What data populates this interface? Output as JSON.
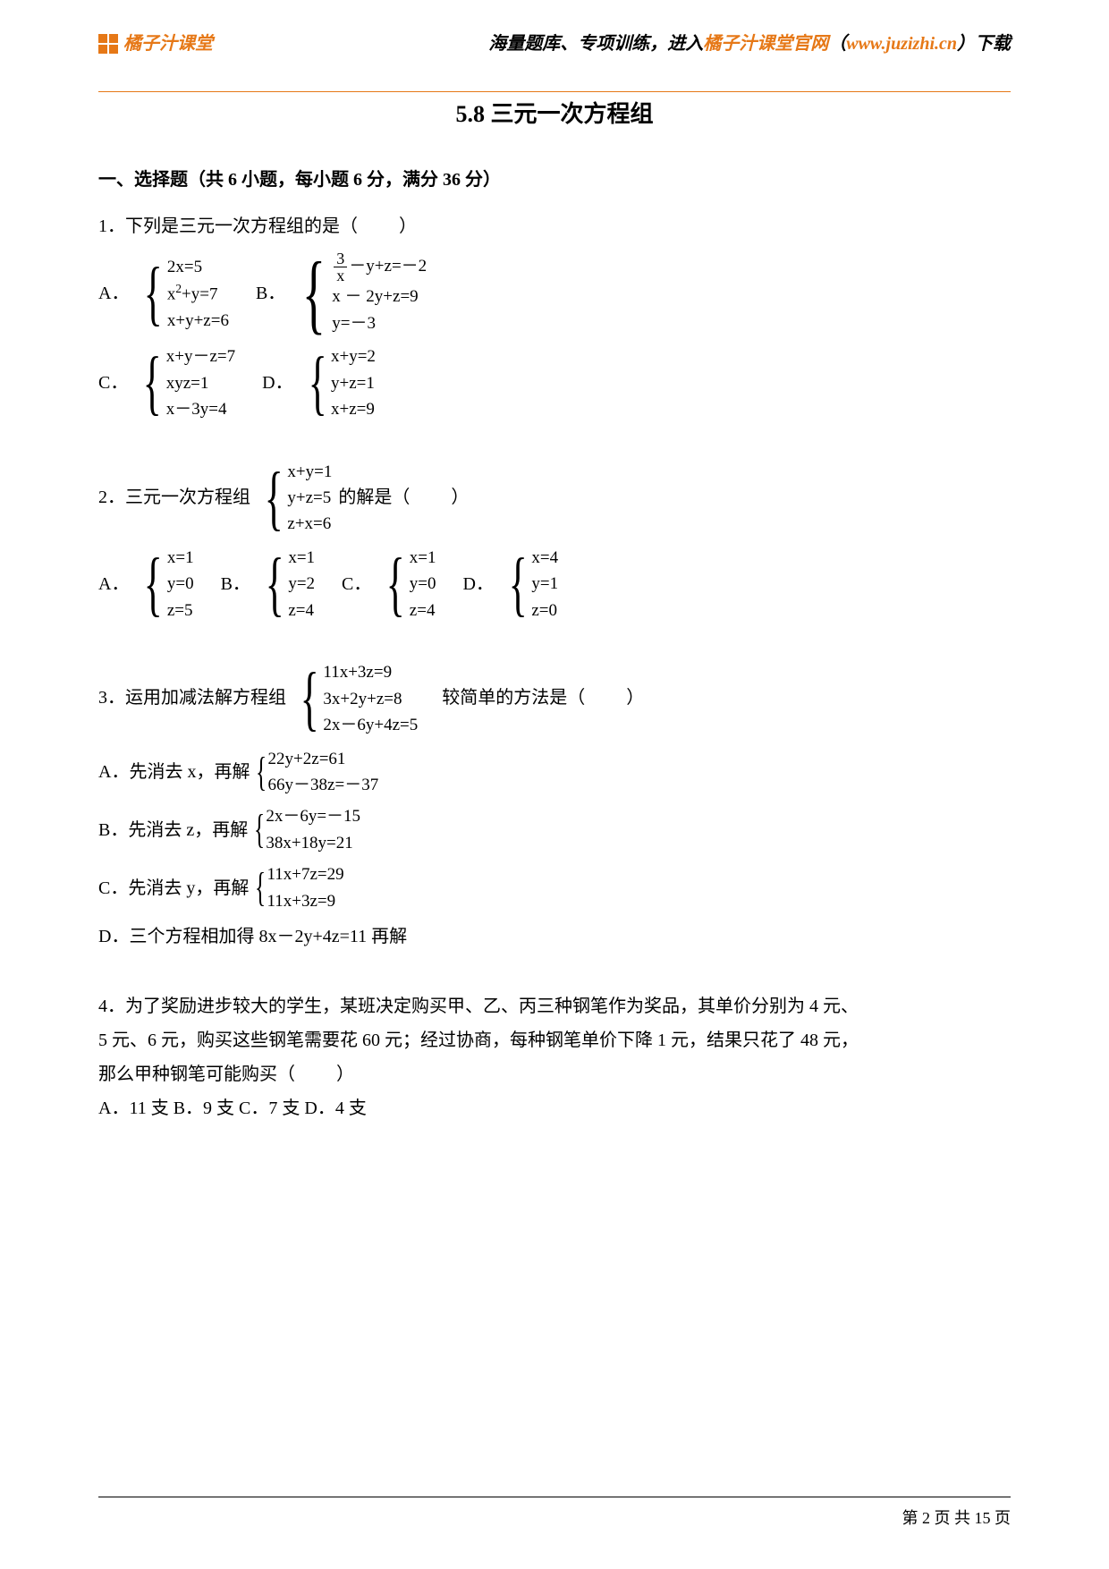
{
  "header": {
    "logo_text": "橘子汁课堂",
    "right_prefix": "海量题库、专项训练，进入",
    "right_site": "橘子汁课堂官网",
    "right_paren_open": "（",
    "right_url": "www.juzizhi.cn",
    "right_paren_close": "）",
    "right_suffix": "下载"
  },
  "title": "5.8 三元一次方程组",
  "section1": "一、选择题（共 6 小题，每小题 6 分，满分 36 分）",
  "blank": "（　　）",
  "q1": {
    "stem": "1．下列是三元一次方程组的是",
    "A": {
      "label": "A．",
      "lines": [
        "2x=5",
        "x²+y=7",
        "x+y+z=6"
      ]
    },
    "B": {
      "label": "B．",
      "lines_html": [
        "(3/x) － y+z=－2",
        "x － 2y+z=9",
        "y=－3"
      ]
    },
    "C": {
      "label": "C．",
      "lines": [
        "x+y－z=7",
        "xyz=1",
        "x－3y=4"
      ]
    },
    "D": {
      "label": "D．",
      "lines": [
        "x+y=2",
        "y+z=1",
        "x+z=9"
      ]
    }
  },
  "q2": {
    "stem_pre": "2．三元一次方程组",
    "sys": [
      "x+y=1",
      "y+z=5",
      "z+x=6"
    ],
    "stem_post": "的解是",
    "A": {
      "label": "A．",
      "lines": [
        "x=1",
        "y=0",
        "z=5"
      ]
    },
    "B": {
      "label": "B．",
      "lines": [
        "x=1",
        "y=2",
        "z=4"
      ]
    },
    "C": {
      "label": "C．",
      "lines": [
        "x=1",
        "y=0",
        "z=4"
      ]
    },
    "D": {
      "label": "D．",
      "lines": [
        "x=4",
        "y=1",
        "z=0"
      ]
    }
  },
  "q3": {
    "stem_pre": "3．运用加减法解方程组",
    "sys": [
      "11x+3z=9",
      "3x+2y+z=8",
      "2x－6y+4z=5"
    ],
    "stem_post": "　较简单的方法是",
    "A": {
      "label": "A．",
      "text": "先消去 x，再解",
      "lines": [
        "22y+2z=61",
        "66y－38z=－37"
      ]
    },
    "B": {
      "label": "B．",
      "text": "先消去 z，再解",
      "lines": [
        "2x－6y=－15",
        "38x+18y=21"
      ]
    },
    "C": {
      "label": "C．",
      "text": "先消去 y，再解",
      "lines": [
        "11x+7z=29",
        "11x+3z=9"
      ]
    },
    "D": {
      "label": "D．",
      "text": "三个方程相加得 8x－2y+4z=11 再解"
    }
  },
  "q4": {
    "stem_line1": "4．为了奖励进步较大的学生，某班决定购买甲、乙、丙三种钢笔作为奖品，其单价分别为 4 元、",
    "stem_line2": "5 元、6 元，购买这些钢笔需要花 60 元；经过协商，每种钢笔单价下降 1 元，结果只花了 48 元，",
    "stem_line3": "那么甲种钢笔可能购买",
    "opts": "A．11 支 B．9 支 C．7 支 D．4 支"
  },
  "footer": {
    "page": "第 2 页 共 15 页"
  }
}
